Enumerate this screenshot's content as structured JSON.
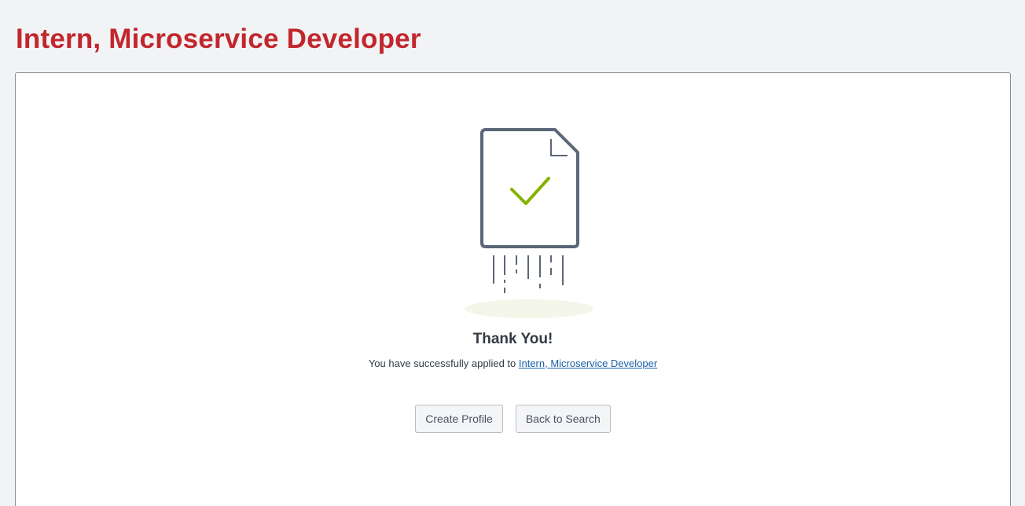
{
  "header": {
    "title": "Intern, Microservice Developer"
  },
  "confirmation": {
    "icon": "document-check-icon",
    "heading": "Thank You!",
    "message_prefix": "You have successfully applied to",
    "job_link": "Intern, Microservice Developer"
  },
  "actions": {
    "create_profile_label": "Create Profile",
    "back_to_search_label": "Back to Search"
  },
  "colors": {
    "title": "#c1272d",
    "icon_stroke": "#5b6677",
    "check": "#84b300",
    "link": "#1a5fa8"
  }
}
